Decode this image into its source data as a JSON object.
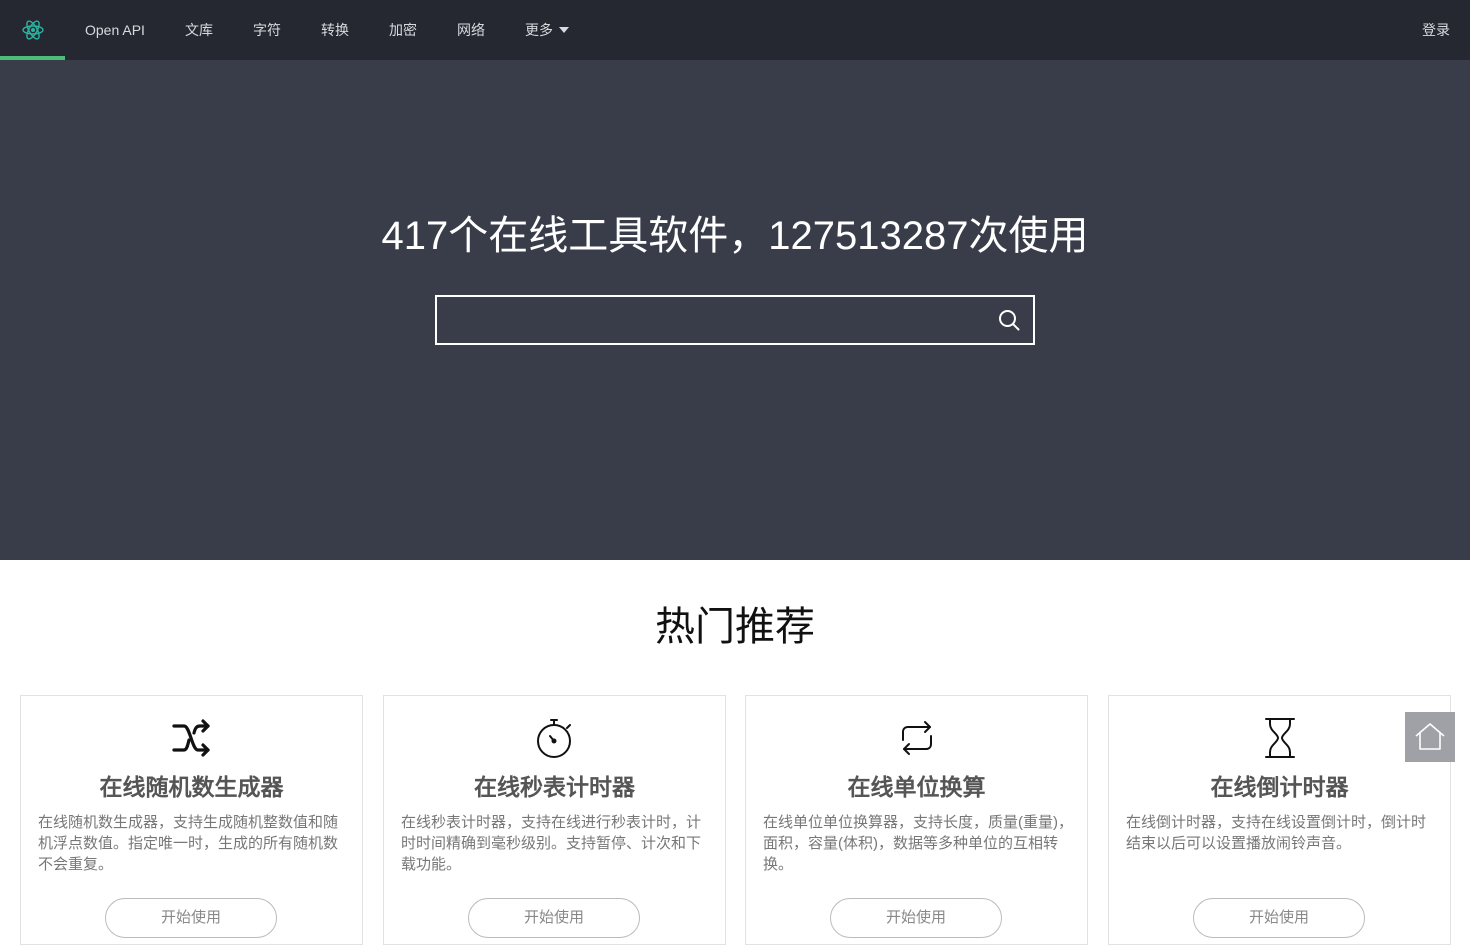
{
  "nav": {
    "logo_icon": "atom-gear-icon",
    "items": [
      {
        "label": "Open API"
      },
      {
        "label": "文库"
      },
      {
        "label": "字符"
      },
      {
        "label": "转换"
      },
      {
        "label": "加密"
      },
      {
        "label": "网络"
      },
      {
        "label": "更多"
      }
    ],
    "login_label": "登录",
    "accent_color": "#4ebb7a"
  },
  "hero": {
    "title": "417个在线工具软件，127513287次使用",
    "search": {
      "placeholder": "",
      "value": "",
      "icon": "search-icon"
    }
  },
  "section": {
    "title": "热门推荐"
  },
  "cards": [
    {
      "icon": "shuffle-icon",
      "title": "在线随机数生成器",
      "desc": "在线随机数生成器，支持生成随机整数值和随机浮点数值。指定唯一时，生成的所有随机数不会重复。",
      "button": "开始使用"
    },
    {
      "icon": "stopwatch-icon",
      "title": "在线秒表计时器",
      "desc": "在线秒表计时器，支持在线进行秒表计时，计时时间精确到毫秒级别。支持暂停、计次和下载功能。",
      "button": "开始使用"
    },
    {
      "icon": "repeat-icon",
      "title": "在线单位换算",
      "desc": "在线单位单位换算器，支持长度，质量(重量)，面积，容量(体积)，数据等多种单位的互相转换。",
      "button": "开始使用"
    },
    {
      "icon": "hourglass-icon",
      "title": "在线倒计时器",
      "desc": "在线倒计时器，支持在线设置倒计时，倒计时结束以后可以设置播放闹铃声音。",
      "button": "开始使用"
    }
  ],
  "fab": {
    "icon": "home-icon"
  }
}
